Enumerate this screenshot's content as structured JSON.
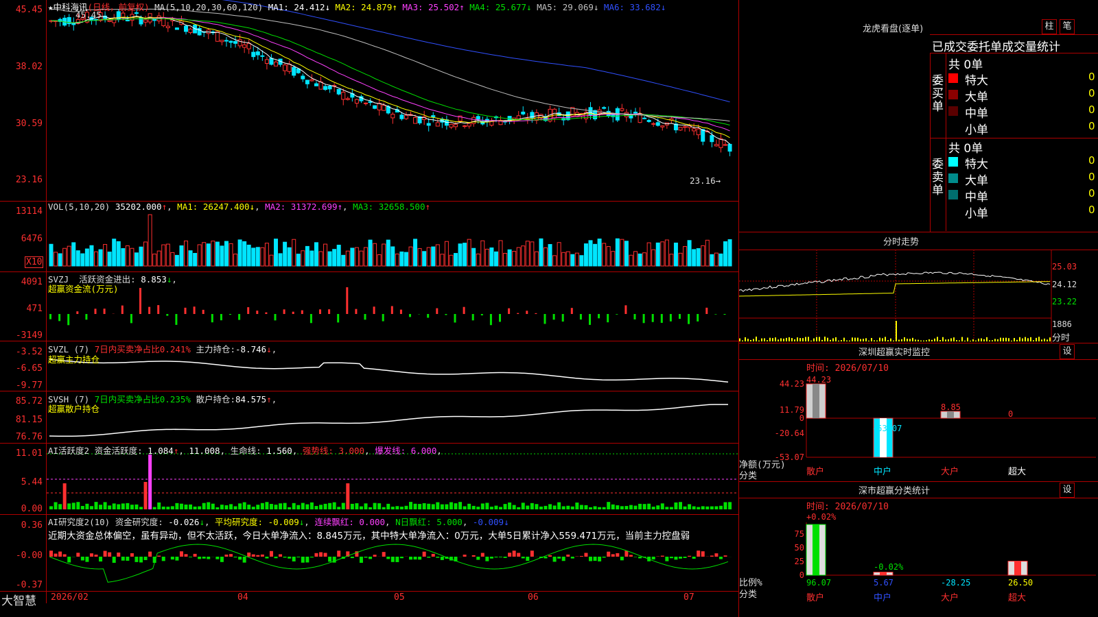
{
  "colors": {
    "up": "#ff3030",
    "down": "#00e5ff",
    "bg": "#000000",
    "grid": "#b00000",
    "ma1": "#ffffff",
    "ma2": "#ffff00",
    "ma3": "#ff40ff",
    "ma4": "#00e000",
    "ma5": "#c0c0c0",
    "ma6": "#3050ff"
  },
  "brand": "大智慧",
  "stock": {
    "star": "★",
    "name": "中科海讯",
    "mode": "(日线，前复权)",
    "ma_title": "MA(5,10,20,30,60,120)"
  },
  "ma_items": [
    {
      "label": "MA1:",
      "value": "24.412",
      "arrow": "↓"
    },
    {
      "label": "MA2:",
      "value": "24.879",
      "arrow": "↑"
    },
    {
      "label": "MA3:",
      "value": "25.502",
      "arrow": "↑"
    },
    {
      "label": "MA4:",
      "value": "25.677",
      "arrow": "↓"
    },
    {
      "label": "MA5:",
      "value": "29.069",
      "arrow": "↓"
    },
    {
      "label": "MA6:",
      "value": "33.682",
      "arrow": "↓"
    }
  ],
  "price_axis": [
    "45.45",
    "38.02",
    "30.59",
    "23.16"
  ],
  "price_high": "45.45",
  "price_low": "23.16",
  "vol": {
    "title": "VOL(5,10,20)",
    "value": "35202.000",
    "arrow": "↑",
    "ma1": "26247.400",
    "ma1_arrow": "↓",
    "ma2": "31372.699",
    "ma2_arrow": "↑",
    "ma3": "32658.500",
    "ma3_arrow": "↑",
    "axis": [
      "13114",
      "6476"
    ],
    "unit": "X10"
  },
  "svzj": {
    "title": "SVZJ",
    "label": "活跃资金进出:",
    "value": "8.853",
    "arrow": "↓",
    "sub": "超赢资金流(万元)",
    "axis": [
      "4091",
      "471",
      "-3149"
    ]
  },
  "svzl": {
    "title": "SVZL (7)",
    "ratio": "7日内买卖净占比0.241%",
    "hold_label": "主力持仓:",
    "hold": "-8.746",
    "arrow": "↓",
    "sub": "超赢主力持仓",
    "axis": [
      "-3.52",
      "-6.65",
      "-9.77"
    ]
  },
  "svsh": {
    "title": "SVSH (7)",
    "ratio": "7日内买卖净占比0.235%",
    "hold_label": "散户持仓:",
    "hold": "84.575",
    "arrow": "↑",
    "sub": "超赢散户持仓",
    "axis": [
      "85.72",
      "81.15",
      "76.76"
    ]
  },
  "ai_active": {
    "title": "AI活跃度2",
    "label": "资金活跃度:",
    "value": "1.084",
    "arrow": "↑",
    "v2": "11.008",
    "life_label": "生命线:",
    "life": "1.560",
    "strong_label": "强势线:",
    "strong": "3.000",
    "burst_label": "爆发线:",
    "burst": "6.000",
    "axis": [
      "11.01",
      "5.44",
      "0.00"
    ]
  },
  "ai_research": {
    "title": "AI研究度2(10)",
    "label": "资金研究度:",
    "value": "-0.026",
    "arrow": "↓",
    "avg_label": "平均研究度:",
    "avg": "-0.009",
    "avg_arrow": "↓",
    "red_label": "连续飘红:",
    "red": "0.000",
    "nred_label": "N日飘红:",
    "nred": "5.000",
    "last": "-0.009",
    "last_arrow": "↓",
    "comment": "近期大资金总体偏空，虽有异动，但不太活跃，今日大单净流入：8.845万元，其中特大单净流入：0万元，大单5日累计净入559.471万元，当前主力控盘弱",
    "axis": [
      "0.36",
      "-0.00",
      "-0.37"
    ]
  },
  "dates": [
    "2026/02",
    "04",
    "05",
    "06",
    "07"
  ],
  "lhb": {
    "title": "龙虎看盘(逐单)",
    "btn1": "柱",
    "btn2": "笔",
    "subtitle": "已成交委托单成交量统计",
    "buy": {
      "side": "委买单",
      "total": "共 0单",
      "rows": [
        {
          "label": "特大",
          "val": "0",
          "pct": "0%",
          "color": "#ff0000"
        },
        {
          "label": "大单",
          "val": "0",
          "pct": "0%",
          "color": "#8b0000"
        },
        {
          "label": "中单",
          "val": "0",
          "pct": "0%",
          "color": "#5a0000"
        },
        {
          "label": "小单",
          "val": "0",
          "pct": "0%",
          "color": "#000000"
        }
      ]
    },
    "sell": {
      "side": "委卖单",
      "total": "共 0单",
      "rows": [
        {
          "label": "特大",
          "val": "0",
          "pct": "0%",
          "color": "#00ffff"
        },
        {
          "label": "大单",
          "val": "0",
          "pct": "0%",
          "color": "#008b8b"
        },
        {
          "label": "中单",
          "val": "0",
          "pct": "0%",
          "color": "#006e6e"
        },
        {
          "label": "小单",
          "val": "0",
          "pct": "0%",
          "color": "#000000"
        }
      ]
    }
  },
  "fenshi": {
    "title": "分时走势",
    "axis": [
      "25.03",
      "24.12",
      "23.22",
      "1886",
      "分时"
    ]
  },
  "sz_monitor": {
    "title": "深圳超赢实时监控",
    "btn": "设",
    "time": "时间: 2026/07/10",
    "axis": [
      "44.23",
      "11.79",
      "0",
      "-20.64",
      "-53.07"
    ],
    "ylabel": "净额(万元)",
    "xlabel": "分类",
    "cats": [
      "散户",
      "中户",
      "大户",
      "超大"
    ],
    "values": [
      "44.23",
      "-53.07",
      "8.85",
      "0"
    ]
  },
  "sz_class": {
    "title": "深市超赢分类统计",
    "btn": "设",
    "time": "时间: 2026/07/10",
    "axis": [
      "75",
      "50",
      "25",
      "0"
    ],
    "ylabel": "比例%",
    "xlabel": "分类",
    "cats": [
      "散户",
      "中户",
      "大户",
      "超大"
    ],
    "top_labels": [
      "+0.02%",
      "-0.02%",
      "",
      ""
    ],
    "values": [
      "96.07",
      "5.67",
      "-28.25",
      "26.50"
    ]
  }
}
